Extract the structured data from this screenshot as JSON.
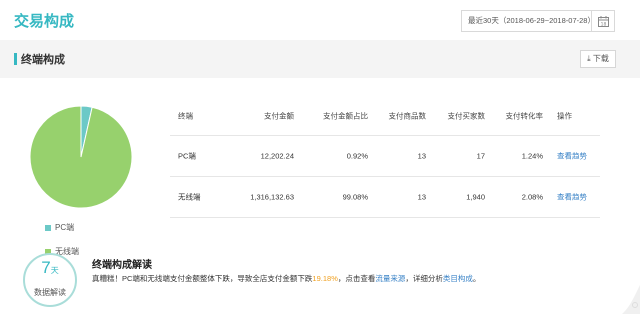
{
  "header": {
    "title": "交易构成",
    "date_range": "最近30天（2018-06-29~2018-07-28）"
  },
  "section": {
    "title": "终端构成",
    "download_label": "下载"
  },
  "pie": {
    "slices": [
      {
        "name": "PC端",
        "share": 0.0092,
        "color": "#6cc9c7"
      },
      {
        "name": "无线端",
        "share": 0.9908,
        "color": "#97d16d"
      }
    ]
  },
  "legend": [
    {
      "label": "PC端",
      "color": "#6cc9c7"
    },
    {
      "label": "无线端",
      "color": "#97d16d"
    }
  ],
  "table": {
    "columns": [
      "终端",
      "支付金额",
      "支付金额占比",
      "支付商品数",
      "支付买家数",
      "支付转化率",
      "操作"
    ],
    "rows": [
      {
        "terminal": "PC端",
        "amount": "12,202.24",
        "ratio": "0.92%",
        "items": "13",
        "buyers": "17",
        "conversion": "1.24%",
        "action": "查看趋势"
      },
      {
        "terminal": "无线端",
        "amount": "1,316,132.63",
        "ratio": "99.08%",
        "items": "13",
        "buyers": "1,940",
        "conversion": "2.08%",
        "action": "查看趋势"
      }
    ]
  },
  "interpretation": {
    "title": "终端构成解读",
    "text_prefix": "真糟糕！PC端和无线端支付金额整体下跌，导致全店支付金额下跌",
    "highlight": "19.18%",
    "text_mid": "，点击查看",
    "link1": "流量来源",
    "text_mid2": "，详细分析",
    "link2": "类目构成",
    "text_suffix": "。"
  },
  "badge": {
    "number": "7",
    "unit": "天",
    "label": "数据解读"
  }
}
